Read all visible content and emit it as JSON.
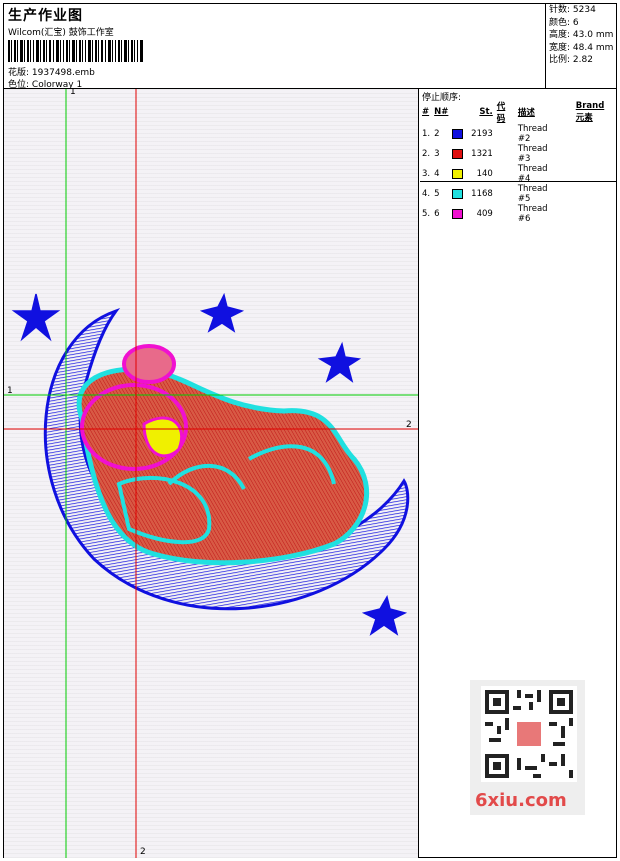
{
  "header": {
    "title": "生产作业图",
    "studio": "Wilcom(汇宝) 鼓饰工作室",
    "design_label": "花版:",
    "design_value": "1937498.emb",
    "colorway_label": "色位:",
    "colorway_value": "Colorway 1"
  },
  "stats": [
    {
      "label": "针数:",
      "value": "5234"
    },
    {
      "label": "颜色:",
      "value": "6"
    },
    {
      "label": "高度:",
      "value": "43.0 mm"
    },
    {
      "label": "宽度:",
      "value": "48.4 mm"
    },
    {
      "label": "比例:",
      "value": "2.82"
    }
  ],
  "stop_sequence": {
    "title": "停止顺序:",
    "headers": [
      "#",
      "N#",
      "St.",
      "代码",
      "描述",
      "Brand",
      "元素"
    ],
    "rows": [
      {
        "num": "1.",
        "n": "2",
        "color": "#1010e0",
        "stitches": "2193",
        "desc": "Thread #2"
      },
      {
        "num": "2.",
        "n": "3",
        "color": "#e01010",
        "stitches": "1321",
        "desc": "Thread #3"
      },
      {
        "num": "3.",
        "n": "4",
        "color": "#f0f000",
        "stitches": "140",
        "desc": "Thread #4"
      },
      {
        "num": "4.",
        "n": "5",
        "color": "#20e0e0",
        "stitches": "1168",
        "desc": "Thread #5"
      },
      {
        "num": "5.",
        "n": "6",
        "color": "#f010d0",
        "stitches": "409",
        "desc": "Thread #6"
      }
    ]
  },
  "axes": {
    "green_top": "1",
    "green_left": "1",
    "red_right": "2",
    "red_bottom": "2"
  },
  "watermark": {
    "site": "6xiu.com"
  },
  "colors": {
    "blue": "#1010e0",
    "red": "#e01010",
    "yellow": "#f0f000",
    "cyan": "#20e0e0",
    "magenta": "#f010d0",
    "green_axis": "#00cc00",
    "red_axis": "#e00000"
  }
}
